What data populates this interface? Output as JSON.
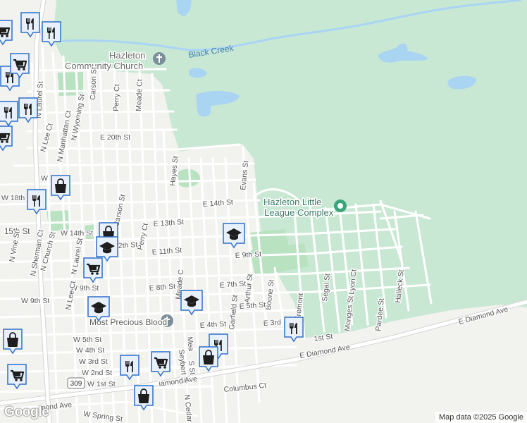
{
  "map": {
    "colors": {
      "land": "#f2f2ef",
      "forest": "#c9e8d4",
      "park": "#b8e2c0",
      "water": "#a9d4f2",
      "road": "#ffffff",
      "major_road": "#ffffff",
      "marker_bg": "#e8f0fb",
      "marker_border": "#2f6fc9",
      "poi": "#4b7b8a"
    },
    "places": {
      "church_north": "Hazleton Community Church",
      "church_south": "Most Precious Blood",
      "park": "Hazleton Little League Complex",
      "creek": "Black Creek"
    },
    "streets": {
      "carson_n": "Carson St",
      "perry_n": "Perry Ct",
      "meade_n": "Meade Ct",
      "n_laurel_n": "N Laurel St",
      "n_manhattan": "N Manhattan Ct",
      "n_wyoming": "N Wyoming St",
      "n_lee_n": "N Lee Ct",
      "e_20th": "E 20th St",
      "w_18th": "W 18th St",
      "w_19th": "W",
      "hayes": "Hayes St",
      "evans": "Evans St",
      "e_14th": "E 14th St",
      "e_13th": "E 13th St",
      "carson_s": "Carson St",
      "perry_s": "Perry Ct",
      "w_15th": "15th St",
      "n_church": "N Church St",
      "w_14th": "W 14th St",
      "n_sherman": "N Sherman Ct",
      "n_vine": "N Vine St",
      "n_laurel_s": "N Laurel St",
      "e_12th": "2th St",
      "e_11th": "E 11th St",
      "e_9th": "E 9th St",
      "meade_s": "Meade C",
      "arthur": "Arthur St",
      "boone": "Boone St",
      "fremont": "Fremont",
      "segal": "Segal St",
      "lyon": "Lyon Ct",
      "monges": "Monges St",
      "halleck": "Halleck St",
      "pardee": "Pardee St",
      "e_diamond_r": "E Diamond Ave",
      "e_diamond_l": "E Diamond Ave",
      "e_8th": "E 8th St",
      "e_7th": "E 7th St",
      "garfield": "Garfield St",
      "e_5th": "E 5th St",
      "e_4th": "E 4th St",
      "e_3rd": "E 3rd",
      "e_1st": "1st St",
      "w_9th_a": "W 9th St",
      "w_9th_b": "W 9th St",
      "n_lee_s": "N Lee Ct",
      "w_5th": "W 5th St",
      "w_4th": "W 4th St",
      "w_3rd": "W 3rd St",
      "w_2nd": "W 2nd St",
      "w_1st": "W 1st St",
      "meade_st": "Mea",
      "seybert": "Seybert St",
      "n_cedar": "N Cedar St",
      "s_mark": "S St",
      "diamond_sw": "iamond Ave",
      "w_diamond": "mond Ave",
      "columbus": "Columbus Ct",
      "w_spring": "W Spring St",
      "route": "309",
      "diamond_ave_mid": "Diamond Ave"
    }
  },
  "google_logo": "Google",
  "attribution": "Map data ©2025 Google"
}
